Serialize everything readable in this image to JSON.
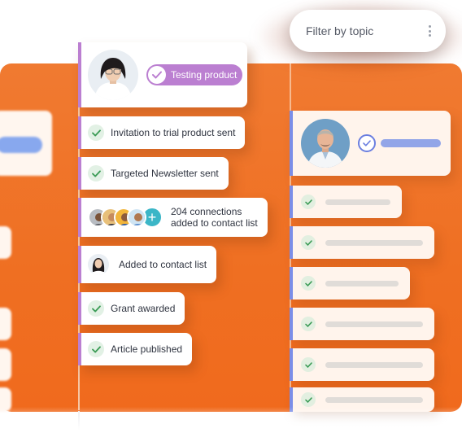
{
  "filter": {
    "label": "Filter by topic"
  },
  "profile": {
    "tag_label": "Testing product"
  },
  "events": [
    {
      "label": "Invitation to trial product sent",
      "kind": "check"
    },
    {
      "label": "Targeted Newsletter sent",
      "kind": "check"
    },
    {
      "line1": "204 connections",
      "line2": "added to contact list",
      "kind": "connections"
    },
    {
      "label": "Added to contact list",
      "kind": "avatar"
    },
    {
      "label": "Grant awarded",
      "kind": "check"
    },
    {
      "label": "Article published",
      "kind": "check"
    }
  ],
  "colors": {
    "background": "#ef6f22",
    "accent_purple": "#bb7fd1",
    "accent_blue": "#7b8ee8",
    "check_green": "#3a9b55",
    "plus_teal": "#3bb6c7"
  },
  "icons": [
    "check-icon",
    "plus-icon",
    "kebab-menu-icon"
  ]
}
